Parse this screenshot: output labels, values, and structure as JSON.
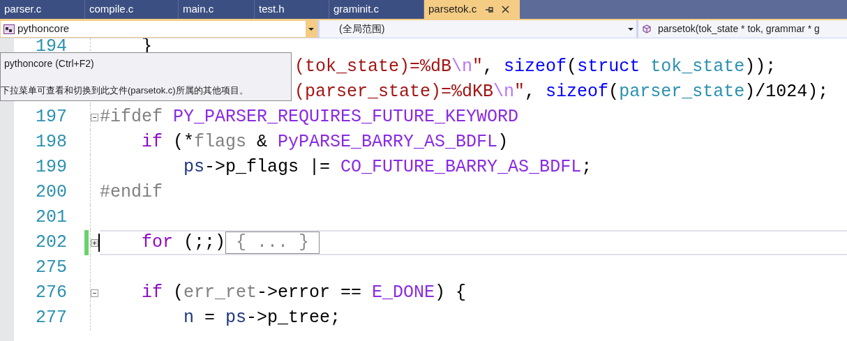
{
  "tabs": [
    {
      "label": "parser.c",
      "selected": false
    },
    {
      "label": "compile.c",
      "selected": false
    },
    {
      "label": "main.c",
      "selected": false
    },
    {
      "label": "test.h",
      "selected": false
    },
    {
      "label": "graminit.c",
      "selected": false
    },
    {
      "label": "parsetok.c",
      "selected": true
    }
  ],
  "navigation_bar": {
    "project": "pythoncore",
    "scope": "(全局范围)",
    "member": "parsetok(tok_state * tok, grammar * g"
  },
  "tooltip": {
    "title": "pythoncore (Ctrl+F2)",
    "description": "下拉菜单可查看和切换到此文件(parsetok.c)所属的其他项目。"
  },
  "editor": {
    "lines": [
      {
        "number": "194",
        "tokens": [
          {
            "kind": "plain",
            "text": "    }"
          }
        ]
      },
      {
        "tokens": [
          {
            "kind": "string",
            "text": "(tok_state)=%dB"
          },
          {
            "kind": "escape",
            "text": "\\n"
          },
          {
            "kind": "string",
            "text": "\""
          },
          {
            "kind": "plain",
            "text": ", "
          },
          {
            "kind": "builtin",
            "text": "sizeof"
          },
          {
            "kind": "plain",
            "text": "("
          },
          {
            "kind": "builtin",
            "text": "struct"
          },
          {
            "kind": "type",
            "text": " tok_state"
          },
          {
            "kind": "plain",
            "text": "));"
          }
        ]
      },
      {
        "tokens": [
          {
            "kind": "string",
            "text": "(parser_state)=%dKB"
          },
          {
            "kind": "escape",
            "text": "\\n"
          },
          {
            "kind": "string",
            "text": "\""
          },
          {
            "kind": "plain",
            "text": ", "
          },
          {
            "kind": "builtin",
            "text": "sizeof"
          },
          {
            "kind": "plain",
            "text": "("
          },
          {
            "kind": "type",
            "text": "parser_state"
          },
          {
            "kind": "plain",
            "text": ")/1024);"
          }
        ]
      },
      {
        "number": "197",
        "folded": false,
        "tokens": [
          {
            "kind": "preproc",
            "text": "#ifdef "
          },
          {
            "kind": "macro",
            "text": "PY_PARSER_REQUIRES_FUTURE_KEYWORD"
          }
        ]
      },
      {
        "number": "198",
        "tokens": [
          {
            "kind": "keyword",
            "text": "    if"
          },
          {
            "kind": "plain",
            "text": " (*"
          },
          {
            "kind": "param",
            "text": "flags"
          },
          {
            "kind": "plain",
            "text": " & "
          },
          {
            "kind": "macro",
            "text": "PyPARSE_BARRY_AS_BDFL"
          },
          {
            "kind": "plain",
            "text": ")"
          }
        ]
      },
      {
        "number": "199",
        "tokens": [
          {
            "kind": "local",
            "text": "        ps"
          },
          {
            "kind": "plain",
            "text": "->p_flags |= "
          },
          {
            "kind": "macro",
            "text": "CO_FUTURE_BARRY_AS_BDFL"
          },
          {
            "kind": "plain",
            "text": ";"
          }
        ]
      },
      {
        "number": "200",
        "tokens": [
          {
            "kind": "preproc",
            "text": "#endif"
          }
        ]
      },
      {
        "number": "201"
      },
      {
        "number": "202",
        "folded": true,
        "changed": true,
        "current": true,
        "tokens": [
          {
            "kind": "keyword",
            "text": "    for"
          },
          {
            "kind": "plain",
            "text": " (;;)"
          },
          {
            "kind": "collapsed",
            "text": "{ ... }"
          }
        ]
      },
      {
        "number": "275"
      },
      {
        "number": "276",
        "folded": false,
        "tokens": [
          {
            "kind": "keyword",
            "text": "    if"
          },
          {
            "kind": "plain",
            "text": " ("
          },
          {
            "kind": "param",
            "text": "err_ret"
          },
          {
            "kind": "plain",
            "text": "->error == "
          },
          {
            "kind": "macro",
            "text": "E_DONE"
          },
          {
            "kind": "plain",
            "text": ") {"
          }
        ]
      },
      {
        "number": "277",
        "tokens": [
          {
            "kind": "local",
            "text": "        n"
          },
          {
            "kind": "plain",
            "text": " = "
          },
          {
            "kind": "local",
            "text": "ps"
          },
          {
            "kind": "plain",
            "text": "->p_tree;"
          }
        ]
      }
    ]
  }
}
